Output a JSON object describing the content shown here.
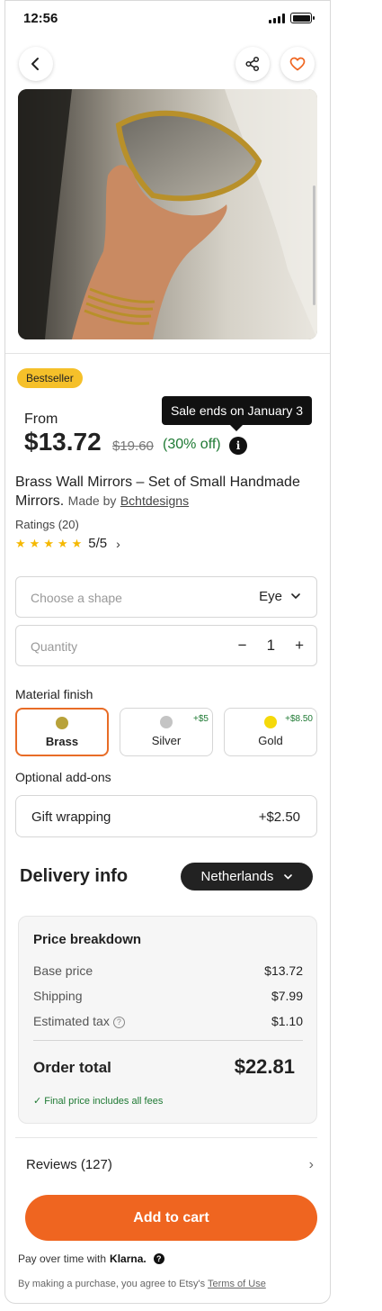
{
  "status": {
    "time": "12:56"
  },
  "product": {
    "badge": "Bestseller",
    "tooltip": "Sale ends on January 3",
    "price_prefix": "From",
    "price": "$13.72",
    "old_price": "$19.60",
    "discount": "(30% off)",
    "title": "Brass Wall Mirrors – Set of Small Handmade Mirrors.",
    "made_by_prefix": "Made by",
    "maker": "Bchtdesigns",
    "ratings_label": "Ratings (20)",
    "rating_value": "5/5",
    "stars": 5
  },
  "options": {
    "shape_placeholder": "Choose a shape",
    "shape_value": "Eye",
    "quantity_placeholder": "Quantity",
    "quantity_value": "1",
    "minus": "−",
    "plus": "+"
  },
  "material": {
    "label": "Material finish",
    "finishes": [
      {
        "name": "Brass",
        "surcharge": "",
        "color": "#b8a23a",
        "selected": true
      },
      {
        "name": "Silver",
        "surcharge": "+$5",
        "color": "#c4c4c4",
        "selected": false
      },
      {
        "name": "Gold",
        "surcharge": "+$8.50",
        "color": "#f5d90a",
        "selected": false
      }
    ]
  },
  "addons": {
    "label": "Optional add-ons",
    "items": [
      {
        "name": "Gift wrapping",
        "price": "+$2.50"
      }
    ]
  },
  "delivery": {
    "title": "Delivery info",
    "country": "Netherlands"
  },
  "breakdown": {
    "title": "Price breakdown",
    "rows": [
      {
        "label": "Base price",
        "value": "$13.72"
      },
      {
        "label": "Shipping",
        "value": "$7.99"
      },
      {
        "label": "Estimated tax",
        "value": "$1.10"
      }
    ],
    "total_label": "Order total",
    "total_value": "$22.81",
    "note": "✓ Final price includes all fees"
  },
  "reviews": {
    "label": "Reviews (127)"
  },
  "cta": {
    "add_to_cart": "Add to cart"
  },
  "footer": {
    "klarna_prefix": "Pay over time with",
    "klarna_brand": "Klarna.",
    "terms_prefix": "By making a purchase, you agree to Etsy's",
    "terms_link": "Terms of Use"
  },
  "colors": {
    "accent": "#ef6520",
    "badge": "#f5c02a",
    "success": "#1f7a34"
  }
}
